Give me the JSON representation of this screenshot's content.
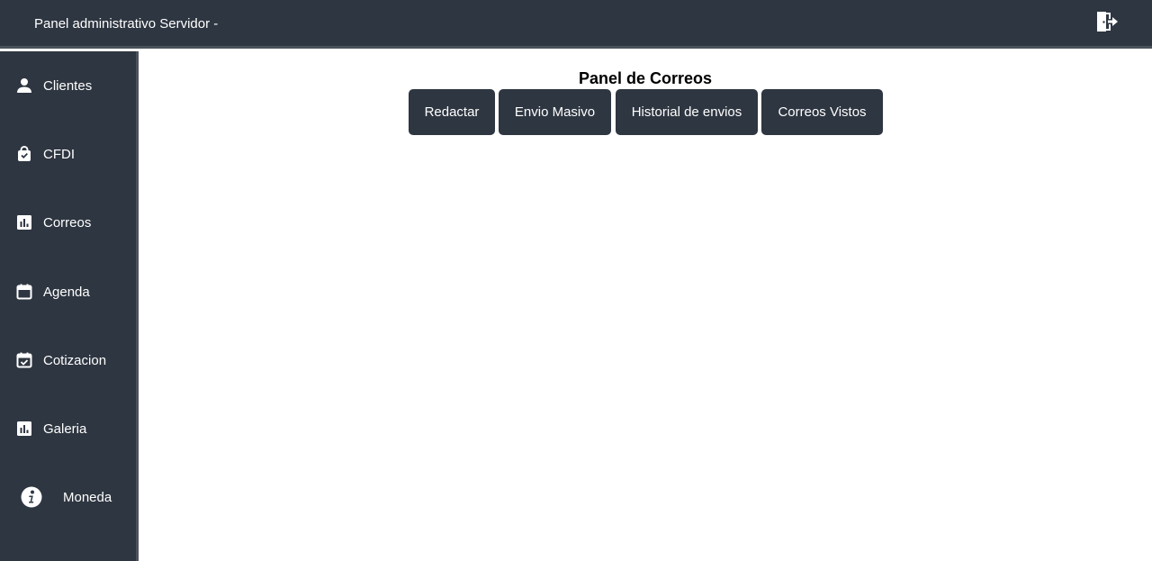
{
  "header": {
    "title": "Panel administrativo Servidor -"
  },
  "sidebar": {
    "items": [
      {
        "label": "Clientes",
        "icon": "person-icon"
      },
      {
        "label": "CFDI",
        "icon": "shopping-bag-icon"
      },
      {
        "label": "Correos",
        "icon": "bar-chart-icon"
      },
      {
        "label": "Agenda",
        "icon": "calendar-icon"
      },
      {
        "label": "Cotizacion",
        "icon": "calendar-check-icon"
      },
      {
        "label": "Galeria",
        "icon": "bar-chart-icon"
      },
      {
        "label": "Moneda",
        "icon": "info-circle-icon"
      }
    ]
  },
  "main": {
    "title": "Panel de Correos",
    "buttons": [
      {
        "label": "Redactar"
      },
      {
        "label": "Envio Masivo"
      },
      {
        "label": "Historial de envios"
      },
      {
        "label": "Correos Vistos"
      }
    ]
  },
  "colors": {
    "bar_bg": "#2e3641",
    "bar_border": "#4a525c",
    "text": "#ffffff"
  }
}
